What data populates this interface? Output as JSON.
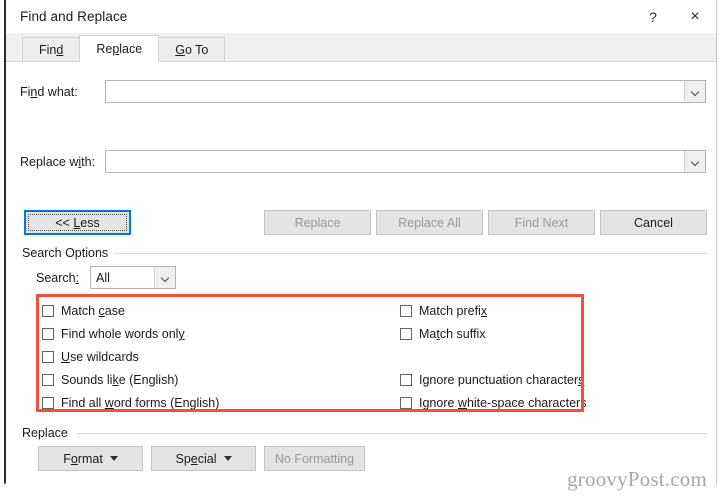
{
  "window": {
    "title": "Find and Replace",
    "help_label": "?",
    "close_label": "×"
  },
  "tabs": [
    {
      "label": "Find",
      "accel_before": "Fin",
      "accel": "d",
      "accel_after": "",
      "active": false
    },
    {
      "label": "Replace",
      "accel_before": "Re",
      "accel": "p",
      "accel_after": "lace",
      "active": true
    },
    {
      "label": "Go To",
      "accel_before": "",
      "accel": "G",
      "accel_after": "o To",
      "active": false
    }
  ],
  "fields": {
    "find_what": {
      "label_before": "Fi",
      "label_accel": "n",
      "label_after": "d what:",
      "value": "",
      "dropdown_icon": "chevron-down-icon"
    },
    "replace_with": {
      "label_before": "Replace w",
      "label_accel": "i",
      "label_after": "th:",
      "value": "",
      "dropdown_icon": "chevron-down-icon"
    }
  },
  "action_buttons": {
    "less": {
      "text_before": "<< ",
      "accel": "L",
      "text_after": "ess",
      "enabled": true,
      "focused": true
    },
    "replace": {
      "label": "Replace",
      "enabled": false
    },
    "replace_all": {
      "label": "Replace All",
      "enabled": false
    },
    "find_next": {
      "label": "Find Next",
      "enabled": false
    },
    "cancel": {
      "label": "Cancel",
      "enabled": true
    }
  },
  "search_options": {
    "group_label": "Search Options",
    "search_label_before": "Search",
    "search_label_accel": ":",
    "search_value": "All",
    "search_dropdown_icon": "chevron-down-icon",
    "left_column": [
      {
        "label_before": "Match ",
        "accel": "c",
        "label_after": "ase",
        "checked": false
      },
      {
        "label_before": "Find whole words onl",
        "accel": "y",
        "label_after": "",
        "checked": false
      },
      {
        "label_before": "",
        "accel": "U",
        "label_after": "se wildcards",
        "checked": false
      },
      {
        "label_before": "Sounds li",
        "accel": "k",
        "label_after": "e (English)",
        "checked": false
      },
      {
        "label_before": "Find all ",
        "accel": "w",
        "label_after": "ord forms (English)",
        "checked": false
      }
    ],
    "right_column": [
      {
        "label_before": "Match prefi",
        "accel": "x",
        "label_after": "",
        "checked": false
      },
      {
        "label_before": "Ma",
        "accel": "t",
        "label_after": "ch suffix",
        "checked": false
      },
      {
        "label_before": "Ignore punctuation character",
        "accel": "s",
        "label_after": "",
        "checked": false
      },
      {
        "label_before": "Ignore ",
        "accel": "w",
        "label_after": "hite-space characters",
        "checked": false
      }
    ],
    "highlight_color": "#f4503c"
  },
  "replace_group": {
    "group_label": "Replace",
    "format": {
      "text_before": "F",
      "accel": "o",
      "text_after": "rmat",
      "enabled": true,
      "has_menu": true
    },
    "special": {
      "text_before": "Sp",
      "accel": "e",
      "text_after": "cial",
      "enabled": true,
      "has_menu": true
    },
    "no_formatting": {
      "label": "No Formatting",
      "enabled": false
    }
  },
  "watermark": {
    "text": "groovyPost.com"
  }
}
